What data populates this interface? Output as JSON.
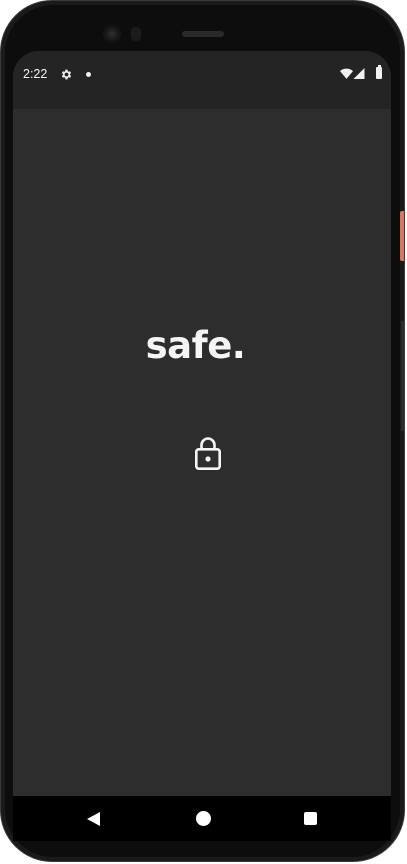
{
  "status_bar": {
    "time": "2:22",
    "left_icons": [
      "gear-icon",
      "notification-dot"
    ],
    "right_icons": [
      "wifi-icon",
      "signal-icon",
      "battery-icon"
    ]
  },
  "app": {
    "title": "safe.",
    "icon": "lock-icon",
    "background_color": "#2d2d2d",
    "text_color": "#f5f5f5"
  },
  "nav_bar": {
    "buttons": [
      "back-button",
      "home-button",
      "recents-button"
    ]
  },
  "device": {
    "accent_button_color": "#d9785f"
  }
}
